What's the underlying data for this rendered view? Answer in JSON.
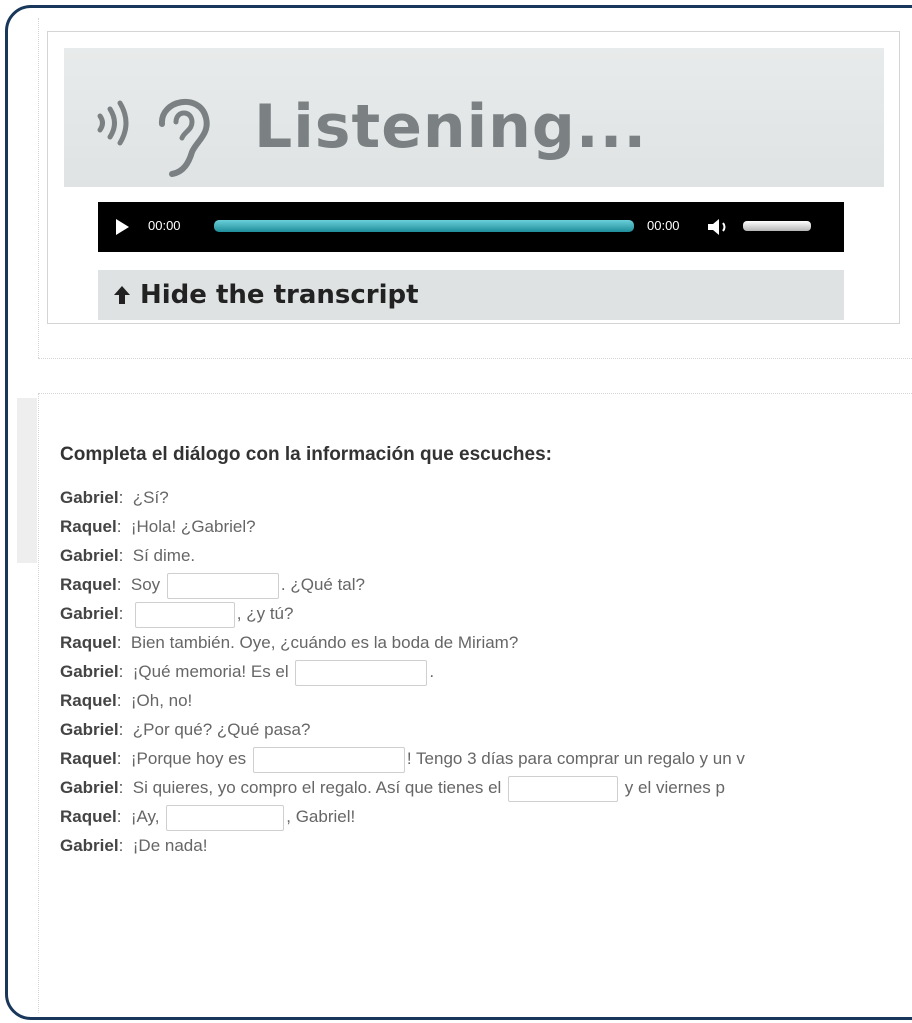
{
  "listening": {
    "title": "Listening...",
    "player": {
      "current_time": "00:00",
      "duration": "00:00"
    },
    "transcript_toggle": "Hide the transcript"
  },
  "exercise": {
    "instruction": "Completa el diálogo con la información que escuches:",
    "lines": [
      {
        "speaker": "Gabriel",
        "parts": [
          "¿Sí?"
        ]
      },
      {
        "speaker": "Raquel",
        "parts": [
          "¡Hola! ¿Gabriel?"
        ]
      },
      {
        "speaker": "Gabriel",
        "parts": [
          "Sí dime."
        ]
      },
      {
        "speaker": "Raquel",
        "parts": [
          "Soy",
          ". ¿Qué tal?"
        ]
      },
      {
        "speaker": "Gabriel",
        "parts": [
          "",
          ", ¿y tú?"
        ]
      },
      {
        "speaker": "Raquel",
        "parts": [
          "Bien también. Oye, ¿cuándo es la boda de Miriam?"
        ]
      },
      {
        "speaker": "Gabriel",
        "parts": [
          "¡Qué memoria! Es el",
          "."
        ]
      },
      {
        "speaker": "Raquel",
        "parts": [
          "¡Oh, no!"
        ]
      },
      {
        "speaker": "Gabriel",
        "parts": [
          "¿Por qué? ¿Qué pasa?"
        ]
      },
      {
        "speaker": "Raquel",
        "parts": [
          "¡Porque hoy es",
          "! Tengo 3 días para comprar un regalo y un v"
        ]
      },
      {
        "speaker": "Gabriel",
        "parts": [
          "Si quieres, yo compro el regalo. Así que tienes el",
          "y el viernes p"
        ]
      },
      {
        "speaker": "Raquel",
        "parts": [
          "¡Ay,",
          ", Gabriel!"
        ]
      },
      {
        "speaker": "Gabriel",
        "parts": [
          "¡De nada!"
        ]
      }
    ]
  },
  "colors": {
    "frame_border": "#18375a",
    "progress_fill": "#2aa3b0",
    "title_gray": "#7b8183"
  },
  "icons": [
    "sound-waves-icon",
    "ear-icon",
    "play-icon",
    "volume-icon",
    "arrow-up-icon"
  ]
}
